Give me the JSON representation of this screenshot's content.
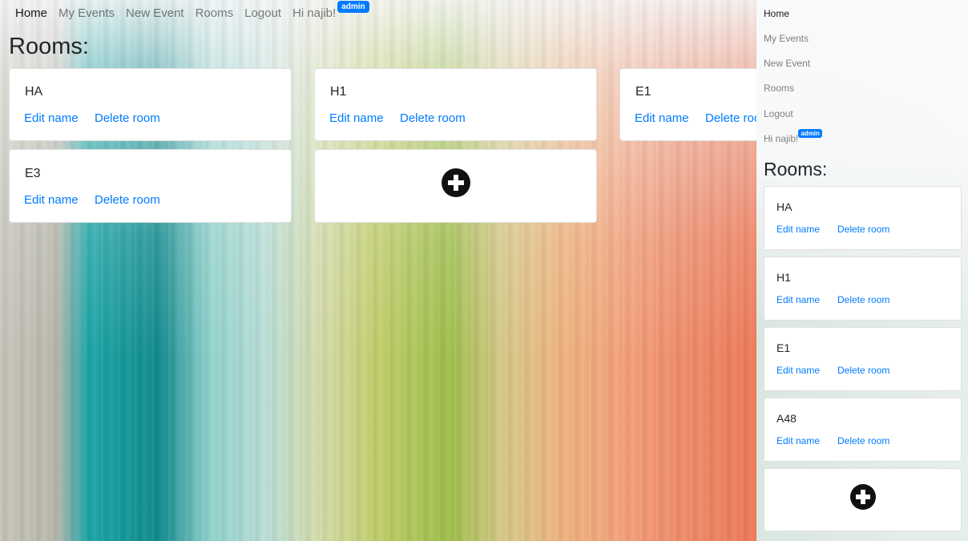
{
  "navbar": {
    "links": [
      "Home",
      "My Events",
      "New Event",
      "Rooms",
      "Logout"
    ],
    "greeting": "Hi najib!",
    "badge": "admin"
  },
  "page": {
    "title": "Rooms:"
  },
  "rooms": [
    "HA",
    "H1",
    "E1",
    "E3",
    "A48"
  ],
  "actions": {
    "edit": "Edit name",
    "delete": "Delete room"
  },
  "add_room_icon": "plus-circle-icon",
  "mobile": {
    "links": [
      "Home",
      "My Events",
      "New Event",
      "Rooms",
      "Logout"
    ],
    "greeting": "Hi najib!",
    "badge": "admin",
    "title": "Rooms:"
  }
}
